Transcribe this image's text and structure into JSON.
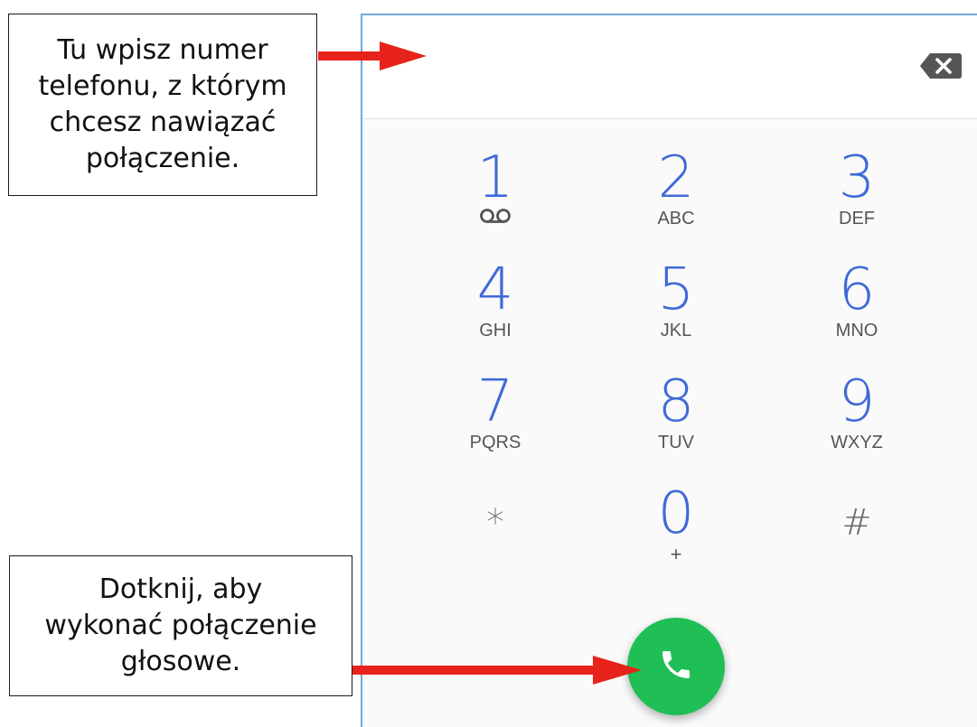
{
  "annotations": {
    "top": {
      "lines": [
        "Tu wpisz numer",
        "telefonu, z którym",
        "chcesz nawiązać",
        "połączenie."
      ]
    },
    "bottom": {
      "lines": [
        "Dotknij, aby",
        "wykonać połączenie",
        "głosowe."
      ]
    }
  },
  "dialer": {
    "number_field": "",
    "backspace_icon": "backspace-icon",
    "keys": [
      {
        "digit": "1",
        "letters": "",
        "icon": "voicemail-icon"
      },
      {
        "digit": "2",
        "letters": "ABC"
      },
      {
        "digit": "3",
        "letters": "DEF"
      },
      {
        "digit": "4",
        "letters": "GHI"
      },
      {
        "digit": "5",
        "letters": "JKL"
      },
      {
        "digit": "6",
        "letters": "MNO"
      },
      {
        "digit": "7",
        "letters": "PQRS"
      },
      {
        "digit": "8",
        "letters": "TUV"
      },
      {
        "digit": "9",
        "letters": "WXYZ"
      },
      {
        "digit": "*",
        "letters": ""
      },
      {
        "digit": "0",
        "letters": "+"
      },
      {
        "digit": "#",
        "letters": ""
      }
    ],
    "call_icon": "phone-icon"
  },
  "colors": {
    "digit_blue": "#3f6ad8",
    "call_green": "#1fbf55",
    "arrow_red": "#e8231c",
    "phone_border": "#6fa8dc"
  }
}
